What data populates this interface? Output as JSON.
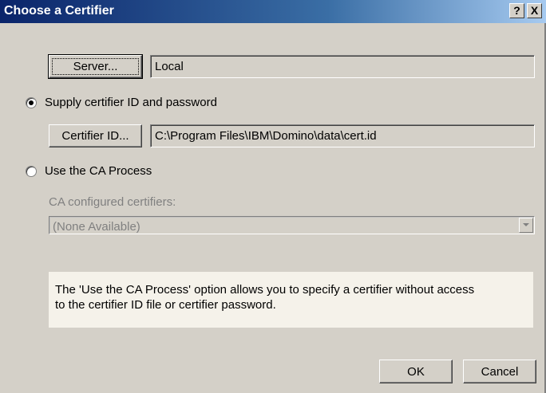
{
  "window": {
    "title": "Choose a Certifier",
    "help_button": "?",
    "close_button": "X"
  },
  "server": {
    "button_label": "Server...",
    "value": "Local"
  },
  "supply_option": {
    "label": "Supply certifier ID and password",
    "selected": true
  },
  "certifier_id": {
    "button_label": "Certifier ID...",
    "value": "C:\\Program Files\\IBM\\Domino\\data\\cert.id"
  },
  "ca_option": {
    "label": "Use the CA Process",
    "selected": false
  },
  "ca_certifiers": {
    "label": "CA configured certifiers:",
    "selected_value": "(None Available)"
  },
  "info": {
    "text": "The 'Use the CA Process' option allows you to specify a certifier without access to the certifier ID file or certifier password."
  },
  "buttons": {
    "ok": "OK",
    "cancel": "Cancel"
  }
}
